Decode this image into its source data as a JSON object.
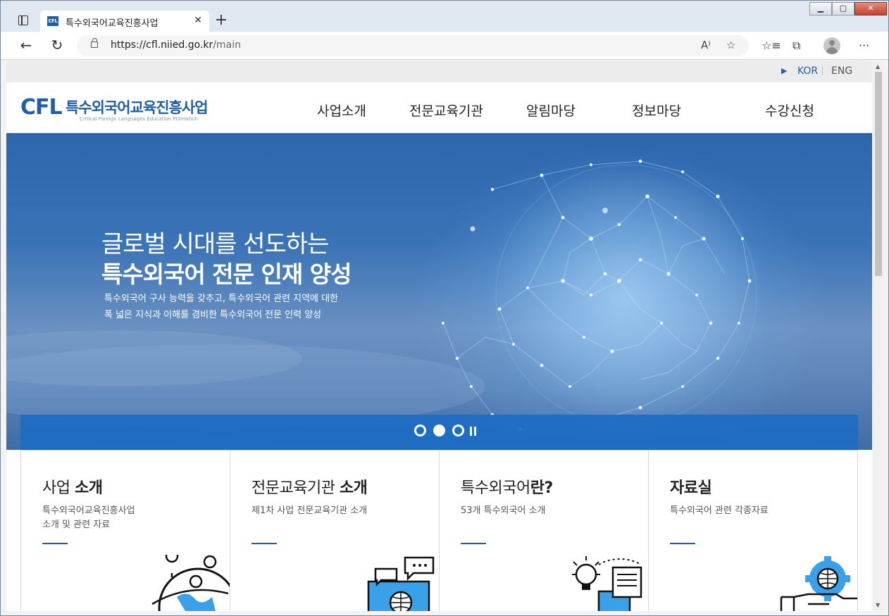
{
  "browser": {
    "tab_title": "특수외국어교육진흥사업",
    "favicon_text": "CFL",
    "url_host": "https://cfl.niied.go.kr",
    "url_path": "/main",
    "new_tab_symbol": "+",
    "tab_close_symbol": "✕"
  },
  "site": {
    "lang": {
      "kor": "KOR",
      "eng": "ENG"
    },
    "logo": {
      "mark": "CFL",
      "title": "특수외국어교육진흥사업",
      "subtitle": "Critical Foreign Languages Education Promotion"
    },
    "nav": [
      "사업소개",
      "전문교육기관",
      "알림마당",
      "정보마당",
      "수강신청"
    ],
    "hero": {
      "line1": "글로벌 시대를 선도하는",
      "line2": "특수외국어 전문 인재 양성",
      "desc1": "특수외국어 구사 능력을 갖추고, 특수외국어 관련 지역에 대한",
      "desc2": "폭 넓은 지식과 이해를 겸비한 특수외국어 전문 인력 양성"
    },
    "cards": [
      {
        "title_plain": "사업 ",
        "title_bold": "소개",
        "desc": "특수외국어교육진흥사업\n소개 및 관련 자료"
      },
      {
        "title_plain": "전문교육기관 ",
        "title_bold": "소개",
        "desc": "제1차 사업 전문교육기관 소개"
      },
      {
        "title_plain": "특수외국어",
        "title_bold": "란?",
        "desc": "53개 특수외국어 소개"
      },
      {
        "title_plain": "",
        "title_bold": "자료실",
        "desc": "특수외국어 관련 각종자료"
      }
    ]
  },
  "colors": {
    "brand": "#1f5fa8",
    "hero_bar": "#1c6cc4"
  }
}
